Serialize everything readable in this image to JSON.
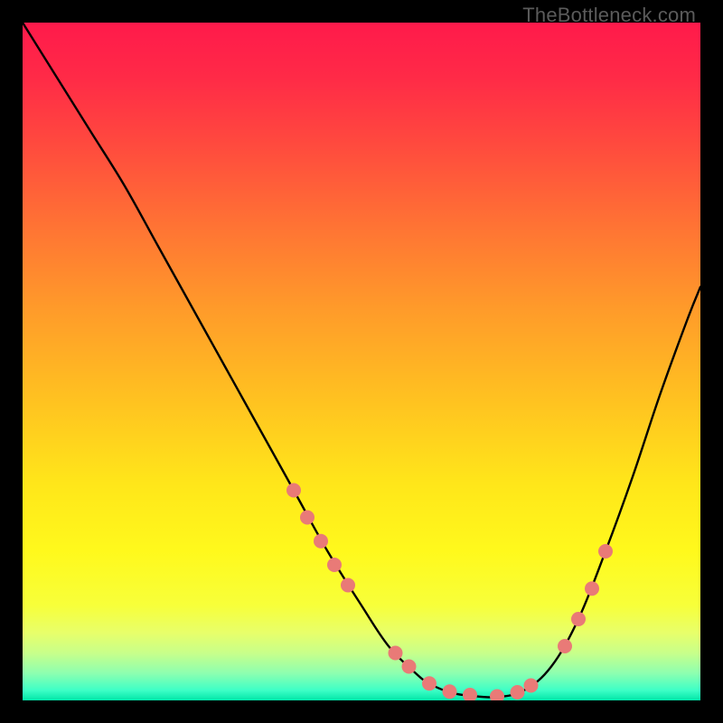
{
  "watermark": "TheBottleneck.com",
  "gradient_stops": [
    {
      "offset": 0.0,
      "color": "#ff1a4b"
    },
    {
      "offset": 0.08,
      "color": "#ff2a47"
    },
    {
      "offset": 0.18,
      "color": "#ff4a3e"
    },
    {
      "offset": 0.3,
      "color": "#ff7334"
    },
    {
      "offset": 0.42,
      "color": "#ff9a2a"
    },
    {
      "offset": 0.55,
      "color": "#ffc021"
    },
    {
      "offset": 0.68,
      "color": "#ffe61a"
    },
    {
      "offset": 0.78,
      "color": "#fff91c"
    },
    {
      "offset": 0.86,
      "color": "#f7ff3a"
    },
    {
      "offset": 0.9,
      "color": "#e8ff6a"
    },
    {
      "offset": 0.93,
      "color": "#c8ff8a"
    },
    {
      "offset": 0.96,
      "color": "#8dffb0"
    },
    {
      "offset": 0.985,
      "color": "#3effc6"
    },
    {
      "offset": 1.0,
      "color": "#00e6a8"
    }
  ],
  "chart_data": {
    "type": "line",
    "title": "",
    "xlabel": "",
    "ylabel": "",
    "xlim": [
      0,
      100
    ],
    "ylim": [
      0,
      100
    ],
    "series": [
      {
        "name": "bottleneck-curve",
        "x": [
          0,
          5,
          10,
          15,
          20,
          25,
          30,
          35,
          40,
          45,
          50,
          54,
          58,
          60,
          63,
          66,
          70,
          74,
          78,
          82,
          86,
          90,
          94,
          98,
          100
        ],
        "y": [
          100,
          92,
          84,
          76,
          67,
          58,
          49,
          40,
          31,
          22,
          14,
          8,
          4,
          2.5,
          1.2,
          0.7,
          0.5,
          1.5,
          5,
          12,
          22,
          33,
          45,
          56,
          61
        ]
      }
    ],
    "markers": {
      "name": "highlight-dots",
      "color": "#e97a77",
      "radius_px": 8,
      "x": [
        40,
        42,
        44,
        46,
        48,
        55,
        57,
        60,
        63,
        66,
        70,
        73,
        75,
        80,
        82,
        84,
        86
      ],
      "y": [
        31,
        27,
        23.5,
        20,
        17,
        7,
        5,
        2.5,
        1.3,
        0.8,
        0.6,
        1.2,
        2.2,
        8,
        12,
        16.5,
        22
      ]
    },
    "grid": false,
    "legend": false
  }
}
